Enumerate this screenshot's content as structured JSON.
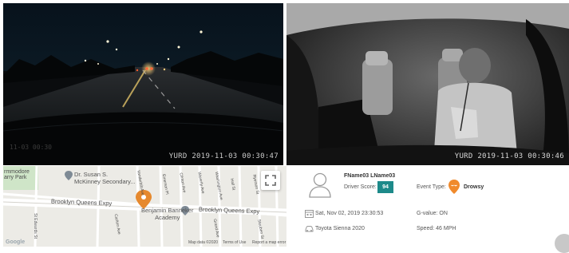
{
  "front_camera": {
    "timestamp": "YURD 2019-11-03 00:30:47",
    "ghost_stamp": "11-03 00:30"
  },
  "cabin_camera": {
    "timestamp": "YURD 2019-11-03 00:30:46"
  },
  "map": {
    "labels": {
      "park": "rmmodore\narry Park",
      "poi": "Dr. Susan S.\nMcKinney Secondary...",
      "expressway_left": "Brooklyn Queens Expy",
      "expressway_right": "Brooklyn Queens Expy",
      "academy": "Benjamin Banneker\nAcademy",
      "st_edwards": "St Edwards St",
      "carlton": "Carlton Ave",
      "vanderbilt": "Vanderbilt Ave",
      "clinton": "Clinton Ave",
      "waverly": "Waverly Ave",
      "washington": "Washington Ave",
      "hall": "Hall St",
      "ryerson": "Ryerson St",
      "grand": "Grand Ave",
      "steuben": "Steuben St",
      "emerson": "Emerson Pl"
    },
    "footer": {
      "logo": "Google",
      "map_data": "Map data ©2020",
      "terms": "Terms of Use",
      "report": "Report a map error"
    }
  },
  "event": {
    "driver_name": "FName03 LName03",
    "driver_score_label": "Driver Score:",
    "driver_score": "94",
    "event_type_label": "Event Type:",
    "event_type": "Drowsy",
    "datetime": "Sat, Nov 02, 2019 23:30:53",
    "vehicle": "Toyota Sienna 2020",
    "g_value": "G-value: ON",
    "speed": "Speed: 46 MPH"
  },
  "colors": {
    "score_badge": "#1d8a8a",
    "event_marker": "#f08a2c",
    "map_pin": "#e6892e"
  }
}
